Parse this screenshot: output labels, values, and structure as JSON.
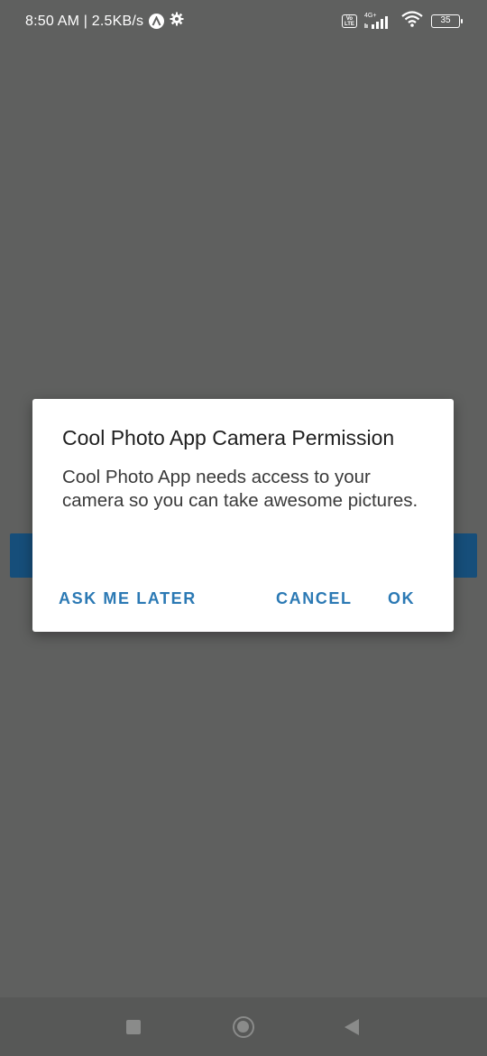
{
  "status_bar": {
    "time_speed": "8:50 AM | 2.5KB/s",
    "network_type": "4G+",
    "volte_label": "Vo LTE",
    "battery": "35",
    "icons": [
      "a-icon",
      "gear-icon",
      "volte-icon",
      "signal-icon",
      "wifi-icon",
      "battery-icon"
    ]
  },
  "dialog": {
    "title": "Cool Photo App Camera Permission",
    "message": "Cool Photo App needs access to your camera so you can take awesome pictures.",
    "buttons": {
      "ask_later": "ASK ME LATER",
      "cancel": "CANCEL",
      "ok": "OK"
    }
  },
  "nav_bar": {
    "icons": [
      "recents-icon",
      "home-icon",
      "back-icon"
    ]
  },
  "colors": {
    "scrim_background": "#5f605f",
    "dialog_background": "#ffffff",
    "accent": "#2b79b4",
    "hidden_button": "#164e7a",
    "nav_bar": "#575857"
  }
}
